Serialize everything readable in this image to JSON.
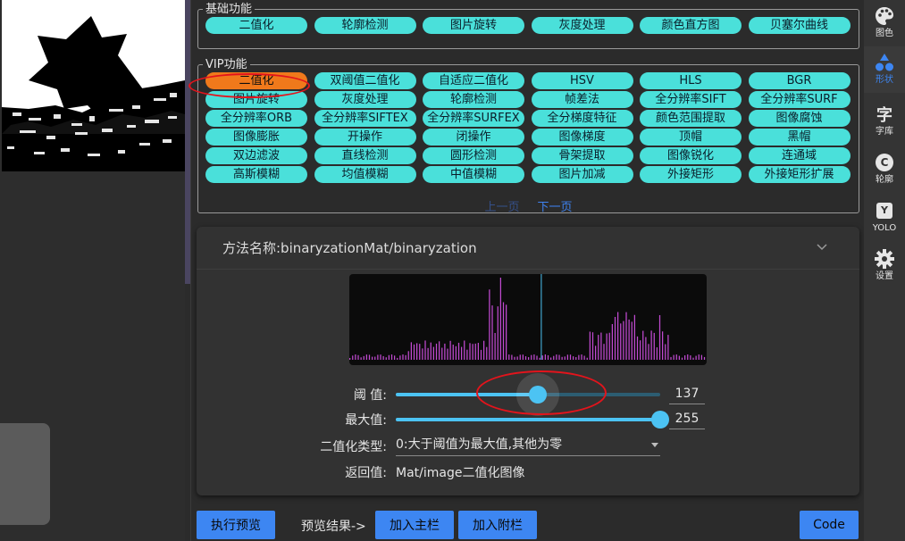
{
  "basic_section": {
    "legend": "基础功能",
    "items": [
      "二值化",
      "轮廓检测",
      "图片旋转",
      "灰度处理",
      "颜色直方图",
      "贝塞尔曲线"
    ]
  },
  "vip_section": {
    "legend": "VIP功能",
    "items": [
      "二值化",
      "双阈值二值化",
      "自适应二值化",
      "HSV",
      "HLS",
      "BGR",
      "图片旋转",
      "灰度处理",
      "轮廓检测",
      "帧差法",
      "全分辨率SIFT",
      "全分辨率SURF",
      "全分辨率ORB",
      "全分辨率SIFTEX",
      "全分辨率SURFEX",
      "全分梯度特征",
      "颜色范围提取",
      "图像腐蚀",
      "图像膨胀",
      "开操作",
      "闭操作",
      "图像梯度",
      "顶帽",
      "黑帽",
      "双边滤波",
      "直线检测",
      "圆形检测",
      "骨架提取",
      "图像锐化",
      "连通域",
      "高斯模糊",
      "均值模糊",
      "中值模糊",
      "图片加减",
      "外接矩形",
      "外接矩形扩展"
    ],
    "active_index": 0,
    "prev_label": "上一页",
    "next_label": "下一页"
  },
  "method_panel": {
    "title": "方法名称:binaryzationMat/binaryzation",
    "histogram_marker": 137,
    "threshold": {
      "label": "阈 值:",
      "value": 137,
      "max": 255
    },
    "max_value": {
      "label": "最大值:",
      "value": 255,
      "max": 255
    },
    "binarize_type": {
      "label": "二值化类型:",
      "value": "0:大于阈值为最大值,其他为零"
    },
    "return_value": {
      "label": "返回值:",
      "value": "Mat/image二值化图像"
    }
  },
  "bottom_bar": {
    "run_preview": "执行预览",
    "preview_result": "预览结果->",
    "add_main": "加入主栏",
    "add_sub": "加入附栏",
    "code": "Code"
  },
  "sidebar": {
    "items": [
      {
        "label": "图色",
        "icon": "palette-icon"
      },
      {
        "label": "形状",
        "icon": "shapes-icon"
      },
      {
        "label": "字库",
        "icon": "font-icon",
        "glyph": "字"
      },
      {
        "label": "轮廓",
        "icon": "contour-icon",
        "glyph": "C"
      },
      {
        "label": "YOLO",
        "icon": "yolo-icon",
        "glyph": "Y"
      },
      {
        "label": "设置",
        "icon": "gear-icon"
      }
    ],
    "active_index": 1
  },
  "colors": {
    "chip": "#4ae0da",
    "chip_active": "#f0791b",
    "accent": "#3d86f2",
    "slider": "#4cc3f3",
    "annotation": "#e3141c",
    "histogram_bar": "#c04ad0",
    "histogram_marker": "#4cc3f3"
  }
}
